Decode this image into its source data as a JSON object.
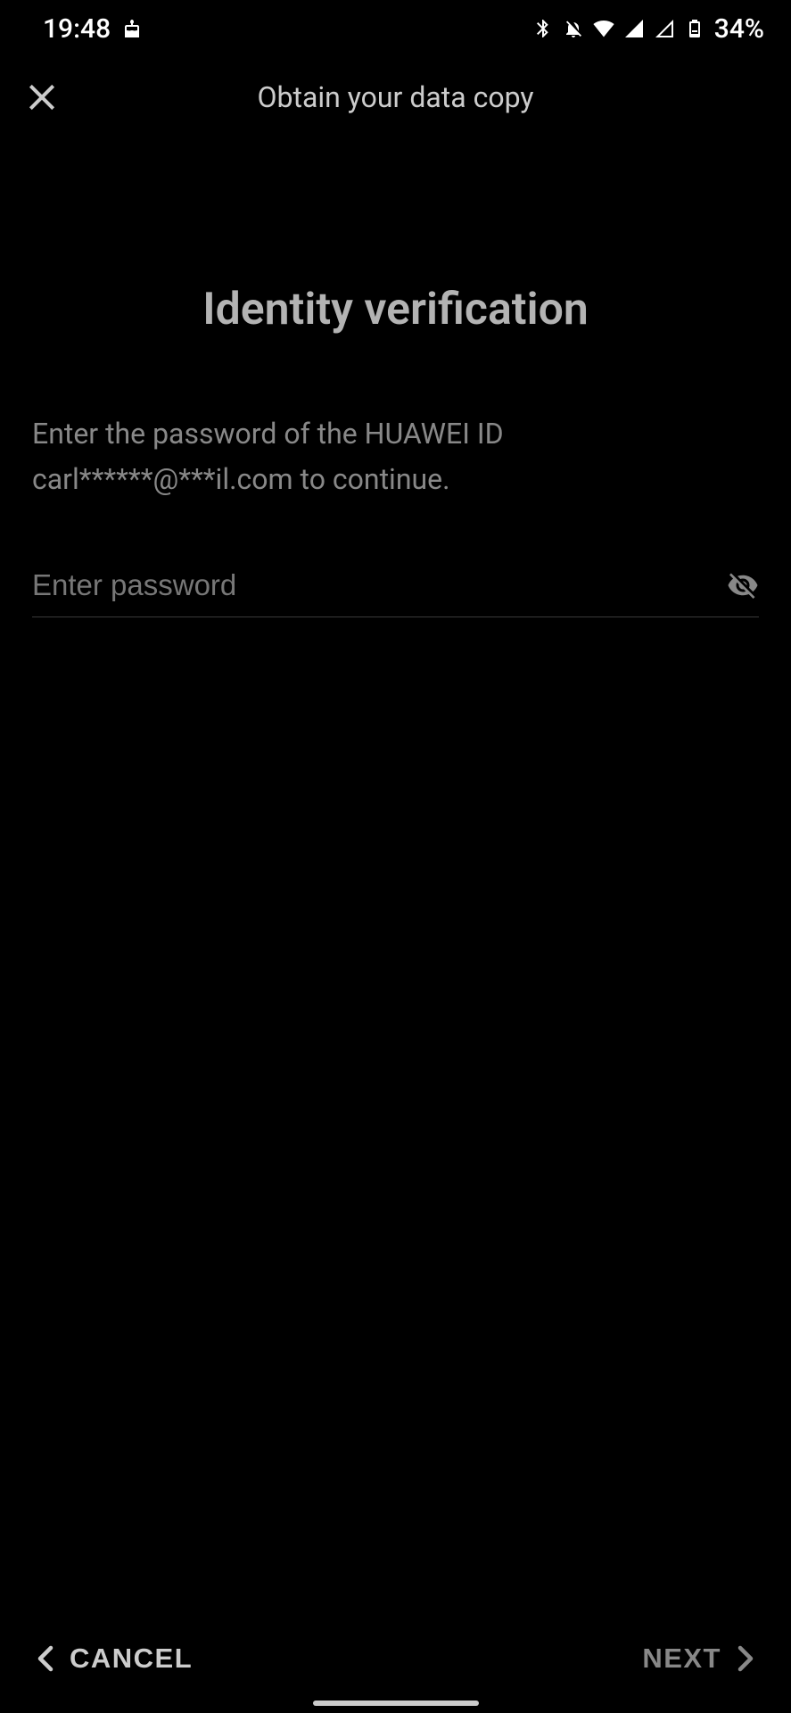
{
  "status_bar": {
    "time": "19:48",
    "battery": "34%"
  },
  "header": {
    "title": "Obtain your data copy"
  },
  "content": {
    "heading": "Identity verification",
    "instruction": "Enter the password of the HUAWEI ID carl******@***il.com to continue.",
    "password_placeholder": "Enter password"
  },
  "buttons": {
    "cancel": "CANCEL",
    "next": "NEXT"
  }
}
